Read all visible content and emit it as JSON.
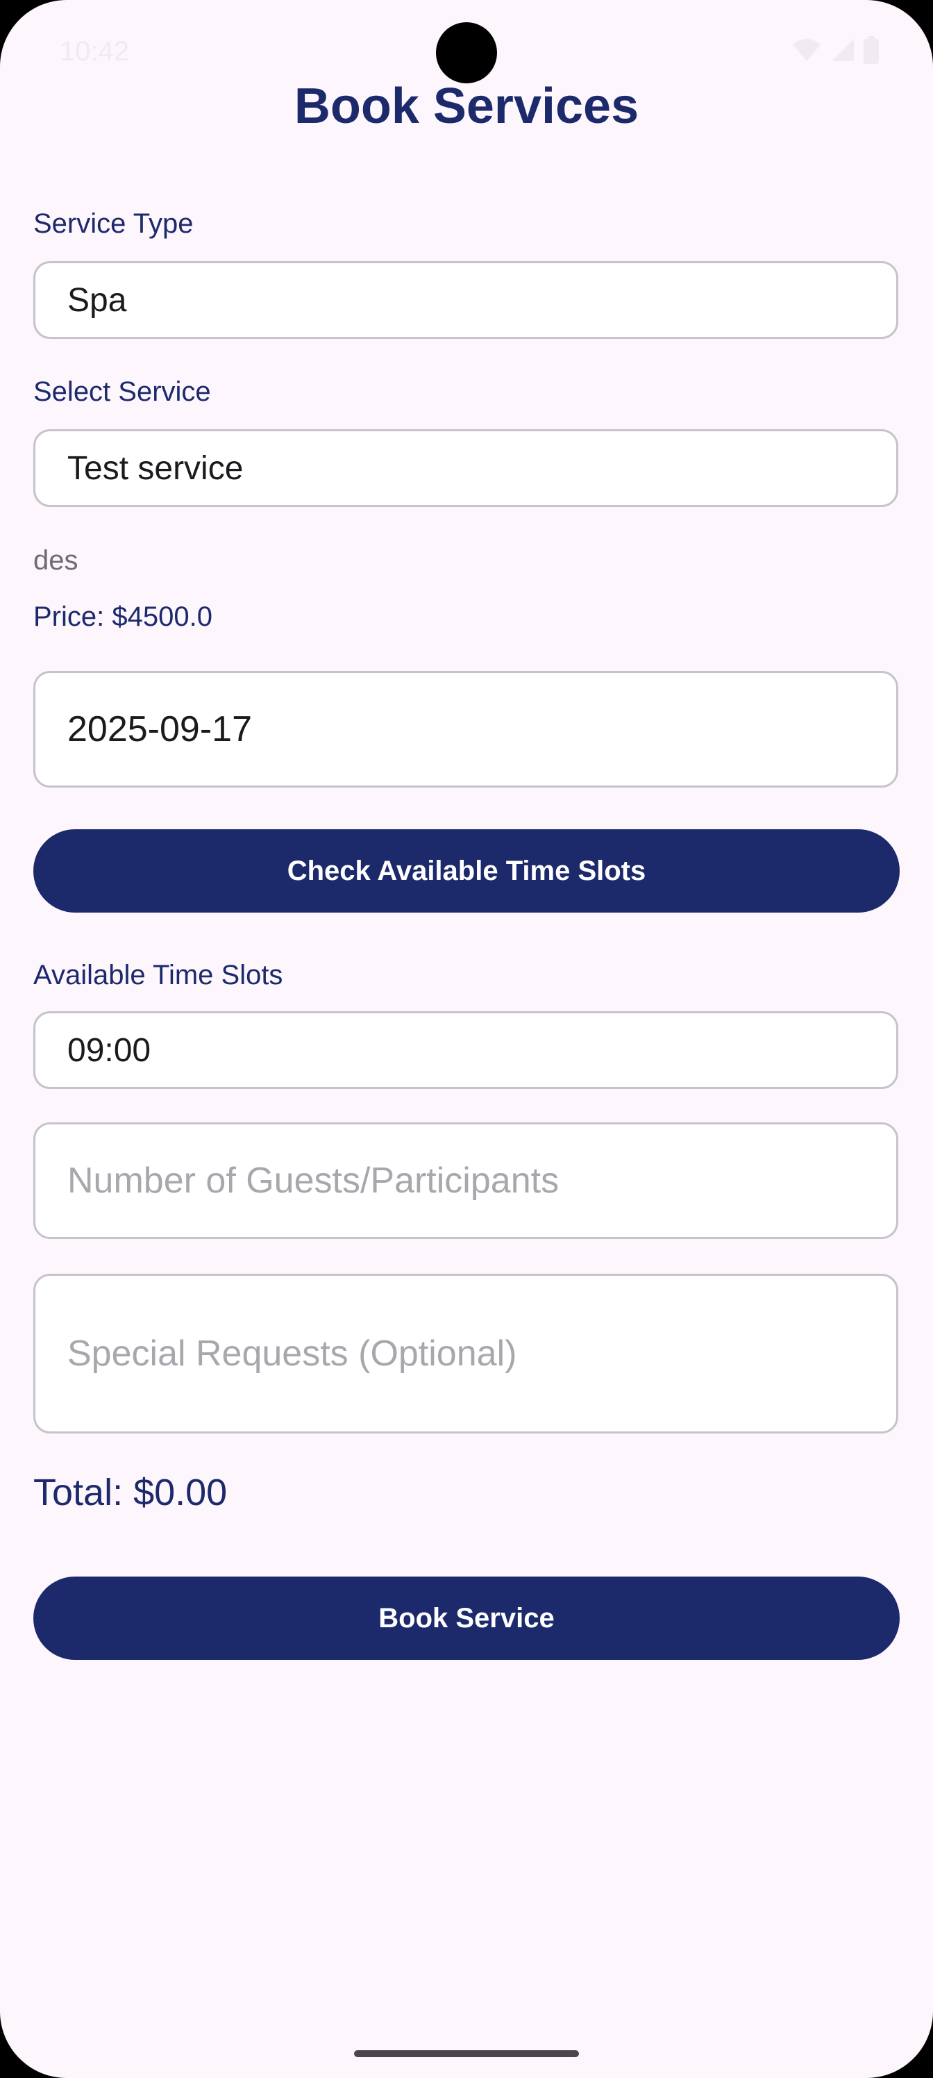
{
  "status_bar": {
    "time": "10:42",
    "icons": [
      "wifi-icon",
      "cellular-signal-icon",
      "battery-icon"
    ]
  },
  "page": {
    "title": "Book Services"
  },
  "form": {
    "service_type": {
      "label": "Service Type",
      "value": "Spa"
    },
    "service": {
      "label": "Select Service",
      "value": "Test service"
    },
    "service_description": "des",
    "price": "Price: $4500.0",
    "date": {
      "value": "2025-09-17"
    },
    "check_slots_button": "Check Available Time Slots",
    "time_slots": {
      "label": "Available Time Slots",
      "value": "09:00"
    },
    "guests": {
      "placeholder": "Number of Guests/Participants"
    },
    "special_requests": {
      "placeholder": "Special Requests (Optional)"
    },
    "total": "Total: $0.00",
    "book_button": "Book Service"
  },
  "colors": {
    "primary": "#1c2a6c",
    "background": "#fdf6fd",
    "border": "#c7c3cc",
    "placeholder": "#a9a6ad"
  }
}
